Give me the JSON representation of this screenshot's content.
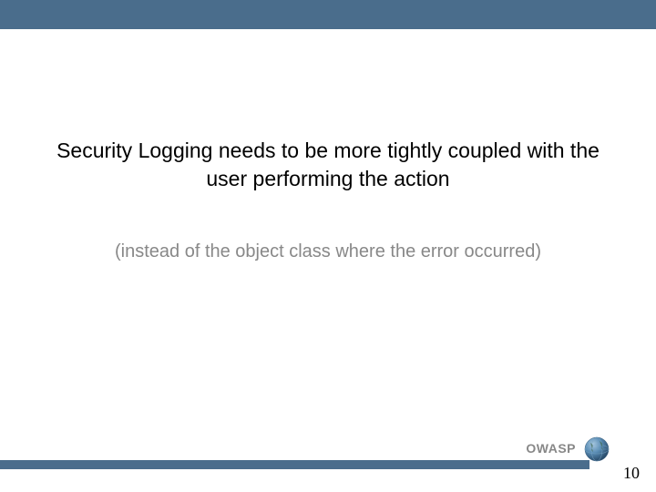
{
  "slide": {
    "main_heading": "Security Logging needs to be more tightly coupled with the user performing the action",
    "sub_heading": "(instead of the object class where the error occurred)"
  },
  "footer": {
    "brand": "OWASP",
    "page_number": "10"
  },
  "colors": {
    "bar": "#4a6d8c",
    "muted": "#888888"
  }
}
